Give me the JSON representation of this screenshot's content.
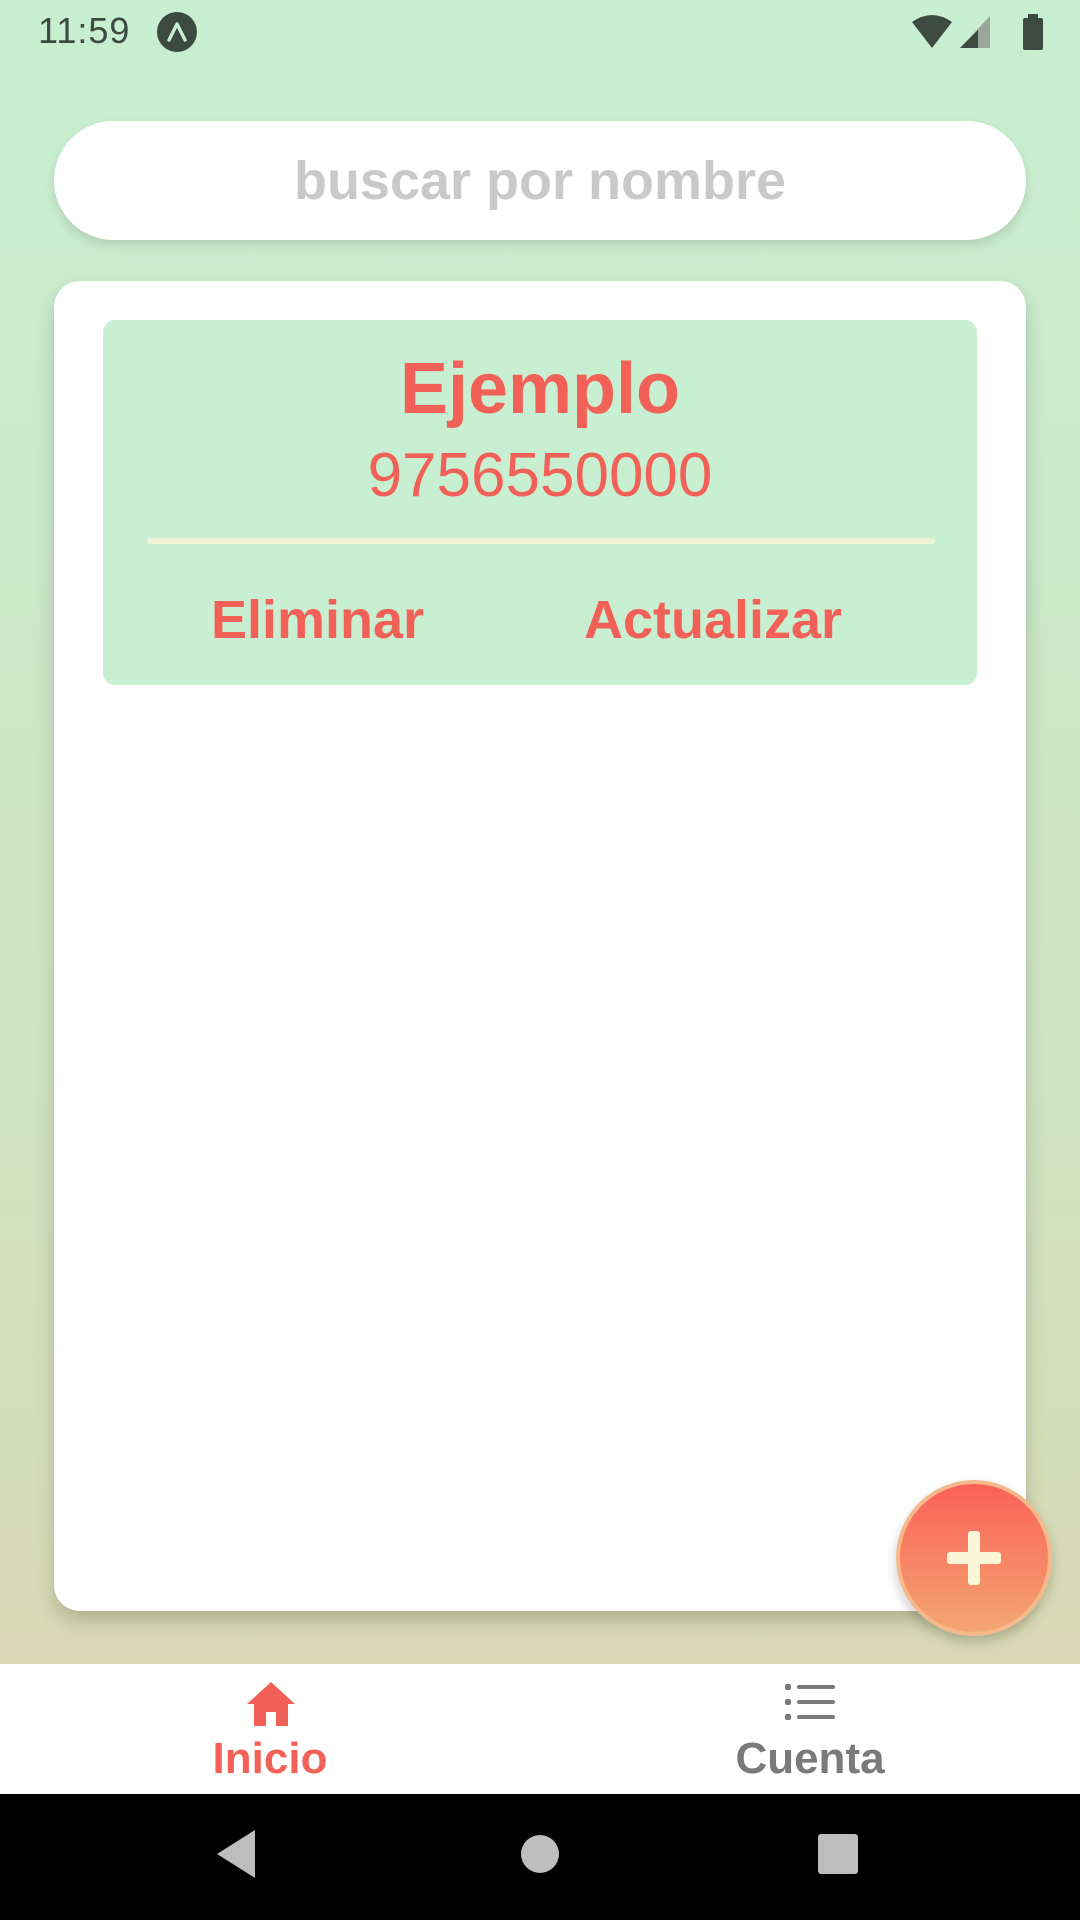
{
  "status_bar": {
    "time": "11:59",
    "app_icon": "expo-a-icon",
    "icons": [
      "wifi-icon",
      "signal-icon",
      "battery-icon"
    ]
  },
  "search": {
    "placeholder": "buscar por nombre",
    "value": ""
  },
  "contacts": [
    {
      "name": "Ejemplo",
      "phone": "9756550000",
      "delete_label": "Eliminar",
      "update_label": "Actualizar"
    }
  ],
  "fab": {
    "icon": "plus-icon"
  },
  "bottom_nav": {
    "items": [
      {
        "label": "Inicio",
        "icon": "home-icon",
        "active": true
      },
      {
        "label": "Cuenta",
        "icon": "list-icon",
        "active": false
      }
    ]
  },
  "colors": {
    "accent": "#f26157",
    "card_background": "#c8efd1",
    "inactive_nav": "#7a7a7a",
    "background_top": "#c8efd1",
    "background_bottom": "#dcd4ad"
  }
}
